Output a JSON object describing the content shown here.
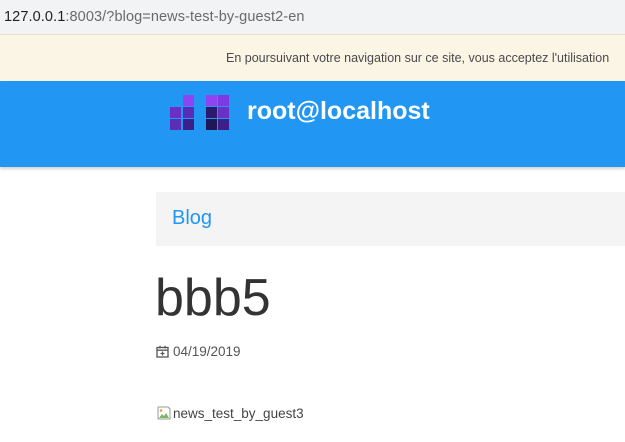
{
  "browser": {
    "url_host": "127.0.0.1",
    "url_rest": ":8003/?blog=news-test-by-guest2-en"
  },
  "cookie_notice": {
    "text": "En poursuivant votre navigation sur ce site, vous acceptez l'utilisation"
  },
  "header": {
    "site_title": "root@localhost",
    "logo_colors": [
      "#8e44f0",
      "#6a2fc4",
      "#3d1f8a",
      "#1e1858"
    ]
  },
  "breadcrumb": {
    "label": "Blog"
  },
  "post": {
    "title": "bbb5",
    "date": "04/19/2019",
    "image_alt": "news_test_by_guest3"
  },
  "icons": [
    "calendar-icon",
    "broken-image-icon"
  ],
  "colors": {
    "accent": "#2196f3",
    "cookie_bg": "#fbf5e6"
  }
}
